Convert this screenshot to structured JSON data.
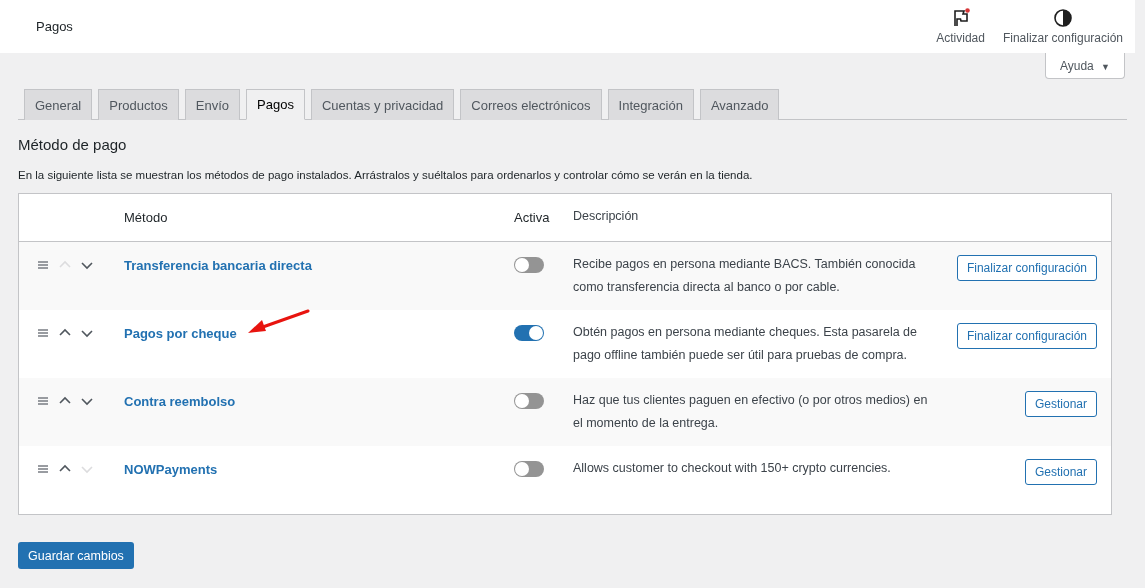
{
  "header": {
    "title": "Pagos",
    "actions": [
      {
        "kind": "activity",
        "label": "Actividad",
        "notification": true
      },
      {
        "kind": "setup",
        "label": "Finalizar configuración"
      }
    ]
  },
  "help_button": {
    "label": "Ayuda",
    "caret": "▼"
  },
  "tabs": [
    {
      "label": "General",
      "selected": false
    },
    {
      "label": "Productos",
      "selected": false
    },
    {
      "label": "Envío",
      "selected": false
    },
    {
      "label": "Pagos",
      "selected": true
    },
    {
      "label": "Cuentas y privacidad",
      "selected": false
    },
    {
      "label": "Correos electrónicos",
      "selected": false
    },
    {
      "label": "Integración",
      "selected": false
    },
    {
      "label": "Avanzado",
      "selected": false
    }
  ],
  "section": {
    "title": "Método de pago",
    "description": "En la siguiente lista se muestran los métodos de pago instalados. Arrástralos y suéltalos para ordenarlos y controlar cómo se verán en la tienda."
  },
  "table": {
    "columns": [
      "Método",
      "Activa",
      "Descripción"
    ],
    "rows": [
      {
        "name": "Transferencia bancaria directa",
        "up_disabled": true,
        "down_disabled": false,
        "on": false,
        "description": "Recibe pagos en persona mediante BACS. También conocida como transferencia directa al banco o por cable.",
        "action": "Finalizar configuración",
        "annotated": false
      },
      {
        "name": "Pagos por cheque",
        "up_disabled": false,
        "down_disabled": false,
        "on": true,
        "description": "Obtén pagos en persona mediante cheques. Esta pasarela de pago offline también puede ser útil para pruebas de compra.",
        "action": "Finalizar configuración",
        "annotated": true
      },
      {
        "name": "Contra reembolso",
        "up_disabled": false,
        "down_disabled": false,
        "on": false,
        "description": "Haz que tus clientes paguen en efectivo (o por otros medios) en el momento de la entrega.",
        "action": "Gestionar",
        "annotated": false
      },
      {
        "name": "NOWPayments",
        "up_disabled": false,
        "down_disabled": true,
        "on": false,
        "description": "Allows customer to checkout with 150+ crypto currencies.",
        "action": "Gestionar",
        "annotated": false
      }
    ]
  },
  "save_button": {
    "label": "Guardar cambios"
  }
}
